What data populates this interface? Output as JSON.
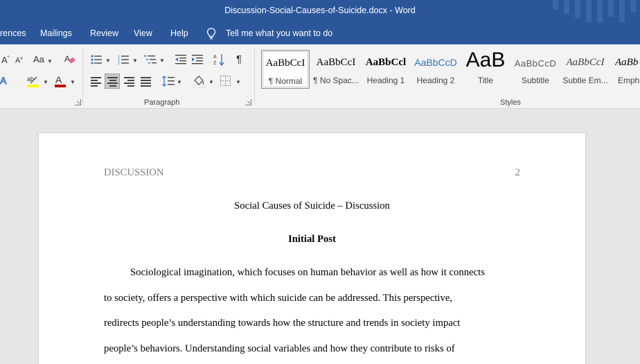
{
  "window": {
    "title": "Discussion-Social-Causes-of-Suicide.docx  -  Word"
  },
  "menu": {
    "items": [
      "rences",
      "Mailings",
      "Review",
      "View",
      "Help"
    ],
    "tell_me": "Tell me what you want to do"
  },
  "ribbon": {
    "font_group": {
      "change_case_label": "Aa",
      "grow_font_label": "A",
      "shrink_font_label": "A"
    },
    "groups": {
      "paragraph_label": "Paragraph",
      "styles_label": "Styles"
    },
    "styles": [
      {
        "preview": "AaBbCcI",
        "name": "¶ Normal"
      },
      {
        "preview": "AaBbCcI",
        "name": "¶ No Spac..."
      },
      {
        "preview": "AaBbCcl",
        "name": "Heading 1"
      },
      {
        "preview": "AaBbCcD",
        "name": "Heading 2"
      },
      {
        "preview": "AaB",
        "name": "Title"
      },
      {
        "preview": "AaBbCcD",
        "name": "Subtitle"
      },
      {
        "preview": "AaBbCcI",
        "name": "Subtle Em..."
      },
      {
        "preview": "AaBb",
        "name": "Emph"
      }
    ],
    "colors": {
      "highlight": "#ffff00",
      "font_color": "#c00000",
      "accent": "#2b579a"
    }
  },
  "document": {
    "header_left": "DISCUSSION",
    "header_right": "2",
    "title": "Social Causes of Suicide – Discussion",
    "subtitle": "Initial Post",
    "lines": [
      "Sociological imagination, which focuses on human behavior as well as how it connects",
      "to society, offers a perspective with which suicide can be addressed. This perspective,",
      "redirects people’s understanding towards how the structure and trends in society impact",
      "people’s behaviors. Understanding social variables and how they contribute to risks of"
    ]
  }
}
